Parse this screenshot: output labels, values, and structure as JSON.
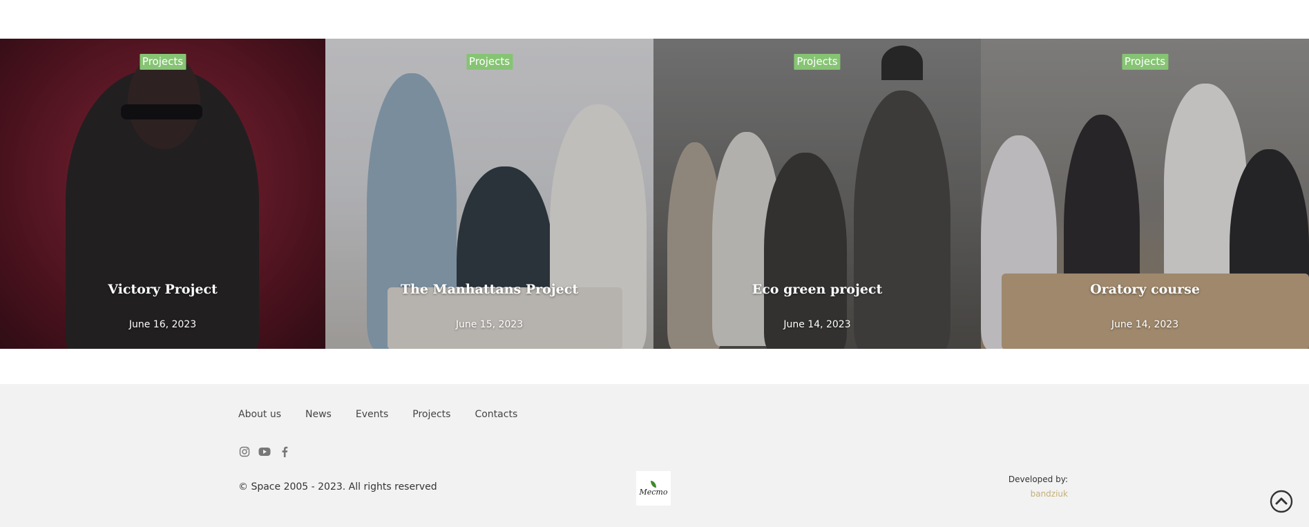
{
  "cards": [
    {
      "badge": "Projects",
      "title": "Victory Project",
      "date": "June 16, 2023"
    },
    {
      "badge": "Projects",
      "title": "The Manhattans Project",
      "date": "June 15, 2023"
    },
    {
      "badge": "Projects",
      "title": "Eco green project",
      "date": "June 14, 2023"
    },
    {
      "badge": "Projects",
      "title": "Oratory course",
      "date": "June 14, 2023"
    }
  ],
  "footer": {
    "nav": [
      "About us",
      "News",
      "Events",
      "Projects",
      "Contacts"
    ],
    "social": [
      "instagram-icon",
      "youtube-icon",
      "facebook-icon"
    ],
    "copyright": "© Space 2005 - 2023. All rights reserved",
    "logo_text": "Mecmo",
    "developed_by_label": "Developed by:",
    "developer": "bandziuk"
  },
  "colors": {
    "badge": "#86c474",
    "footer_bg": "#f2f2f2",
    "developer_link": "#c2b078"
  }
}
